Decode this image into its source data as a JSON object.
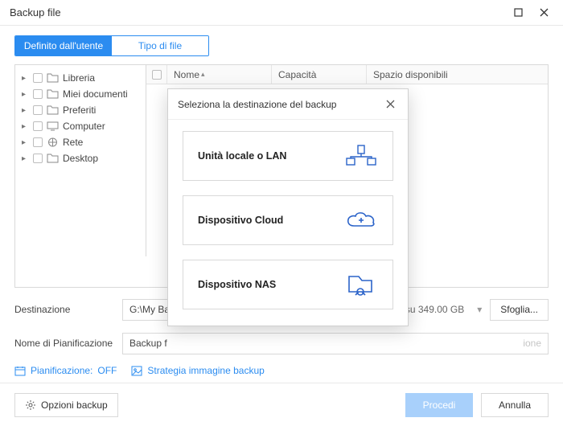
{
  "window": {
    "title": "Backup file"
  },
  "tabs": {
    "user_defined": "Definito dall'utente",
    "file_type": "Tipo di file"
  },
  "tree": {
    "items": [
      {
        "label": "Libreria"
      },
      {
        "label": "Miei documenti"
      },
      {
        "label": "Preferiti"
      },
      {
        "label": "Computer"
      },
      {
        "label": "Rete"
      },
      {
        "label": "Desktop"
      }
    ]
  },
  "list": {
    "columns": {
      "name": "Nome",
      "capacity": "Capacità",
      "free": "Spazio disponibili"
    }
  },
  "destination": {
    "label": "Destinazione",
    "path": "G:\\My Ba",
    "free_label": "su 349.00 GB",
    "browse": "Sfoglia..."
  },
  "schedule_name": {
    "label": "Nome di Pianificazione",
    "value": "Backup f",
    "placeholder_tail": "ione"
  },
  "links": {
    "schedule": "Pianificazione:",
    "schedule_state": "OFF",
    "strategy": "Strategia immagine backup"
  },
  "bottom": {
    "options": "Opzioni backup",
    "proceed": "Procedi",
    "cancel": "Annulla"
  },
  "modal": {
    "title": "Seleziona la destinazione del backup",
    "options": [
      {
        "label": "Unità locale o LAN"
      },
      {
        "label": "Dispositivo Cloud"
      },
      {
        "label": "Dispositivo NAS"
      }
    ]
  }
}
